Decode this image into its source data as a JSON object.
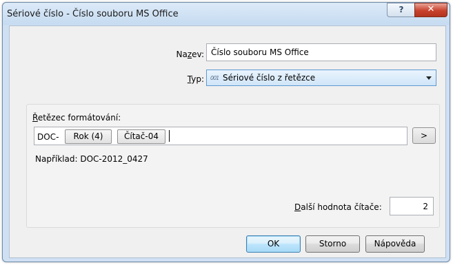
{
  "window": {
    "title": "Sériové číslo - Číslo souboru MS Office",
    "help_glyph": "?",
    "close_glyph": "✕"
  },
  "form": {
    "name_label_pre": "Na",
    "name_label_u": "z",
    "name_label_post": "ev:",
    "name_value": "Číslo souboru MS Office",
    "type_label_u": "T",
    "type_label_post": "yp:",
    "type_icon_text": "001",
    "type_value": "Sériové číslo z řetězce",
    "type_icon": "numbered-document-icon"
  },
  "format": {
    "label_u": "Ř",
    "label_post": "etězec formátování:",
    "prefix": "DOC-",
    "chip_year": "Rok (4)",
    "chip_counter": "Čítač-04",
    "insert_button": ">",
    "example": "Například: DOC-2012_0427"
  },
  "counter": {
    "label_u": "D",
    "label_post": "alší hodnota čítače:",
    "value": "2"
  },
  "buttons": {
    "ok": "OK",
    "cancel": "Storno",
    "help": "Nápověda"
  }
}
